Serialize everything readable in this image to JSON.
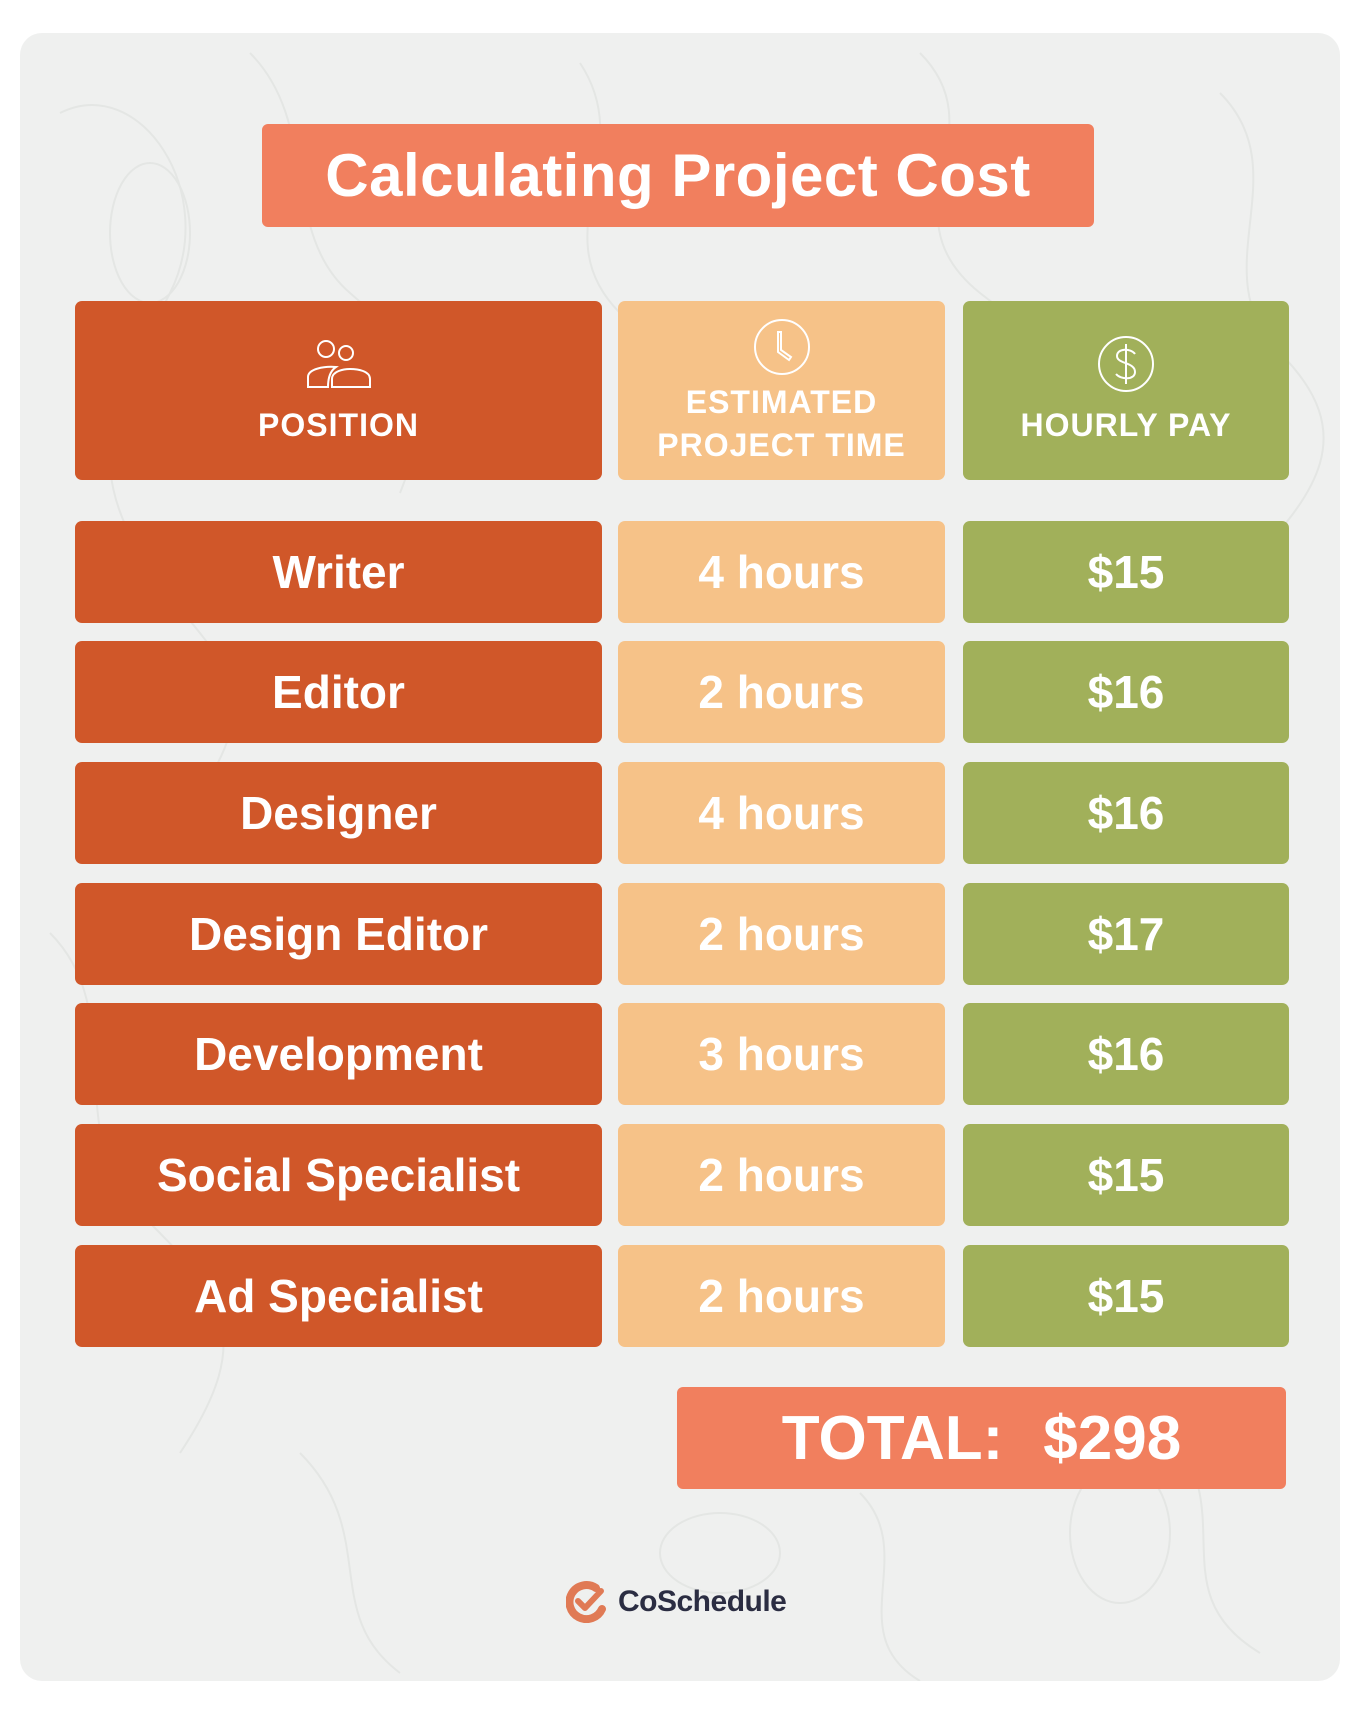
{
  "title": "Calculating Project Cost",
  "headers": [
    {
      "label": "POSITION",
      "icon": "people-icon"
    },
    {
      "label_line1": "ESTIMATED",
      "label_line2": "PROJECT TIME",
      "icon": "clock-icon"
    },
    {
      "label": "HOURLY PAY",
      "icon": "dollar-icon"
    }
  ],
  "rows": [
    {
      "position": "Writer",
      "time": "4 hours",
      "pay": "$15"
    },
    {
      "position": "Editor",
      "time": "2 hours",
      "pay": "$16"
    },
    {
      "position": "Designer",
      "time": "4 hours",
      "pay": "$16"
    },
    {
      "position": "Design Editor",
      "time": "2 hours",
      "pay": "$17"
    },
    {
      "position": "Development",
      "time": "3 hours",
      "pay": "$16"
    },
    {
      "position": "Social Specialist",
      "time": "2 hours",
      "pay": "$15"
    },
    {
      "position": "Ad Specialist",
      "time": "2 hours",
      "pay": "$15"
    }
  ],
  "total": {
    "label": "TOTAL:",
    "value": "$298"
  },
  "brand": {
    "name": "CoSchedule",
    "icon": "coschedule-check-icon"
  },
  "colors": {
    "background": "#eff0ef",
    "title": "#f17f5e",
    "position": "#d05729",
    "time": "#f6c288",
    "pay": "#a1b05a",
    "total": "#f17f5e",
    "brand_text": "#2b2d42",
    "brand_icon": "#e07a55"
  }
}
